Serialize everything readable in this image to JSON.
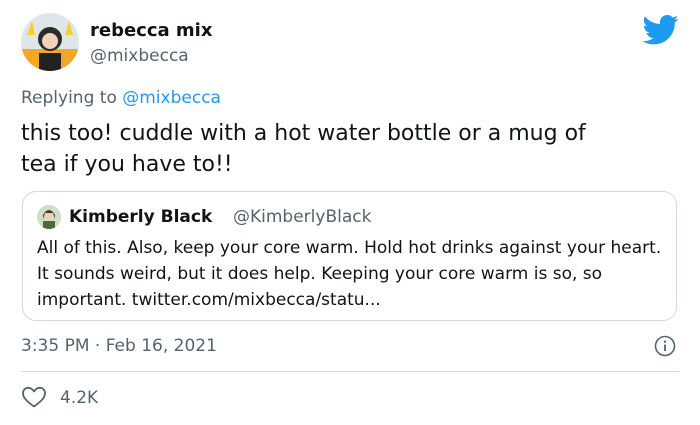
{
  "author": {
    "display_name": "rebecca mix",
    "handle": "@mixbecca",
    "avatar_icon": "profile-avatar"
  },
  "brand": {
    "icon": "twitter-bird-icon",
    "color": "#1d9bf0"
  },
  "reply": {
    "prefix": "Replying to ",
    "mention": "@mixbecca"
  },
  "tweet": {
    "text": "this too! cuddle with a hot water bottle or a mug of\ntea if you have to!!",
    "timestamp": "3:35 PM · Feb 16, 2021",
    "likes": "4.2K"
  },
  "quoted_tweet": {
    "display_name": "Kimberly Black",
    "handle": "@KimberlyBlack",
    "text": "All of this. Also, keep your core warm. Hold hot drinks against your heart. It sounds weird, but it does help. Keeping your core warm is so, so important. twitter.com/mixbecca/statu..."
  },
  "icons": {
    "info": "info-icon",
    "like": "heart-icon"
  }
}
